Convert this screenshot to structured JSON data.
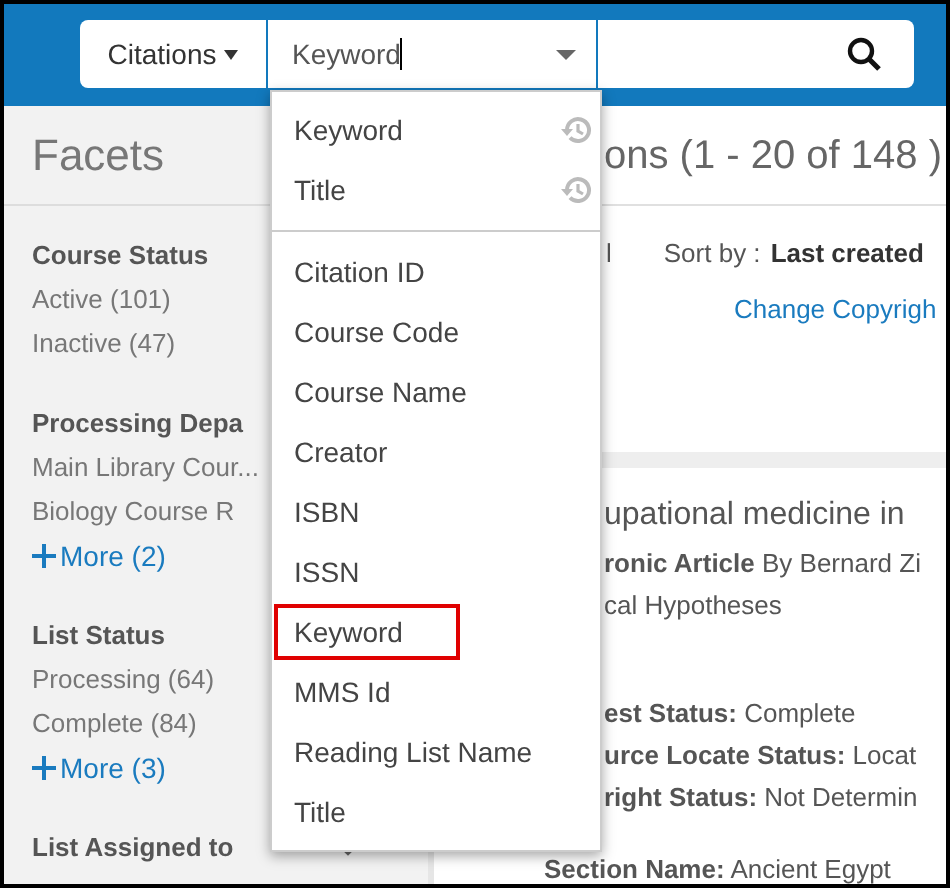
{
  "search_bar": {
    "scope": "Citations",
    "field": "Keyword"
  },
  "search_menu": [
    {
      "kind": "recent",
      "label": "Keyword",
      "highlighted": false
    },
    {
      "kind": "recent",
      "label": "Title",
      "highlighted": false
    },
    {
      "kind": "field",
      "label": "Citation ID",
      "highlighted": false
    },
    {
      "kind": "field",
      "label": "Course Code",
      "highlighted": false
    },
    {
      "kind": "field",
      "label": "Course Name",
      "highlighted": false
    },
    {
      "kind": "field",
      "label": "Creator",
      "highlighted": false
    },
    {
      "kind": "field",
      "label": "ISBN",
      "highlighted": false
    },
    {
      "kind": "field",
      "label": "ISSN",
      "highlighted": false
    },
    {
      "kind": "field",
      "label": "Keyword",
      "highlighted": true
    },
    {
      "kind": "field",
      "label": "MMS Id",
      "highlighted": false
    },
    {
      "kind": "field",
      "label": "Reading List Name",
      "highlighted": false
    },
    {
      "kind": "field",
      "label": "Title",
      "highlighted": false
    }
  ],
  "facets": {
    "title": "Facets",
    "groups": [
      {
        "title": "Course Status",
        "items": [
          "Active (101)",
          "Inactive (47)"
        ]
      },
      {
        "title": "Processing Depa",
        "items": [
          "Main Library Cour...",
          "Biology Course R"
        ],
        "more": "More (2)"
      },
      {
        "title": "List Status",
        "items": [
          "Processing (64)",
          "Complete (84)"
        ],
        "more": "More (3)"
      },
      {
        "title": "List Assigned to",
        "collapsible": true
      }
    ]
  },
  "results": {
    "heading": "ons (1 - 20 of 148 )",
    "fragment": "l",
    "sort_label": "Sort by :",
    "sort_value": "Last created",
    "action_link": "Change Copyrigh",
    "card": {
      "title": "upational medicine in",
      "lines": [
        "**ronic Article** By Bernard Zi",
        "cal Hypotheses"
      ],
      "fields": [
        "**est Status:** Complete",
        "**urce Locate Status:** Locat",
        "**right Status:** Not Determin"
      ],
      "section": "**Section Name:** Ancient Egypt"
    }
  }
}
